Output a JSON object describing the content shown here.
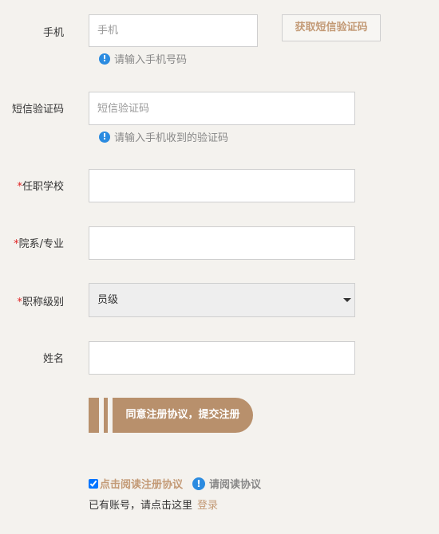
{
  "phone": {
    "label": "手机",
    "placeholder": "手机",
    "hint": "请输入手机号码",
    "sms_button": "获取短信验证码"
  },
  "sms_code": {
    "label": "短信验证码",
    "placeholder": "短信验证码",
    "hint": "请输入手机收到的验证码"
  },
  "school": {
    "required_mark": "*",
    "label": "任职学校",
    "value": ""
  },
  "department": {
    "required_mark": "*",
    "label": "院系/专业",
    "value": ""
  },
  "title_level": {
    "required_mark": "*",
    "label": "职称级别",
    "selected": "员级"
  },
  "name": {
    "label": "姓名",
    "value": ""
  },
  "submit": {
    "label": "同意注册协议，提交注册"
  },
  "agreement": {
    "checked": true,
    "checkbox_label": "点击阅读注册协议",
    "read_link": "请阅读协议"
  },
  "login": {
    "prompt": "已有账号，请点击这里",
    "link": "登录"
  },
  "colors": {
    "accent": "#b8906c",
    "link": "#c39a76",
    "info": "#2b8be0",
    "required": "#e02020"
  },
  "icons": {
    "info": "info-circle-icon"
  }
}
